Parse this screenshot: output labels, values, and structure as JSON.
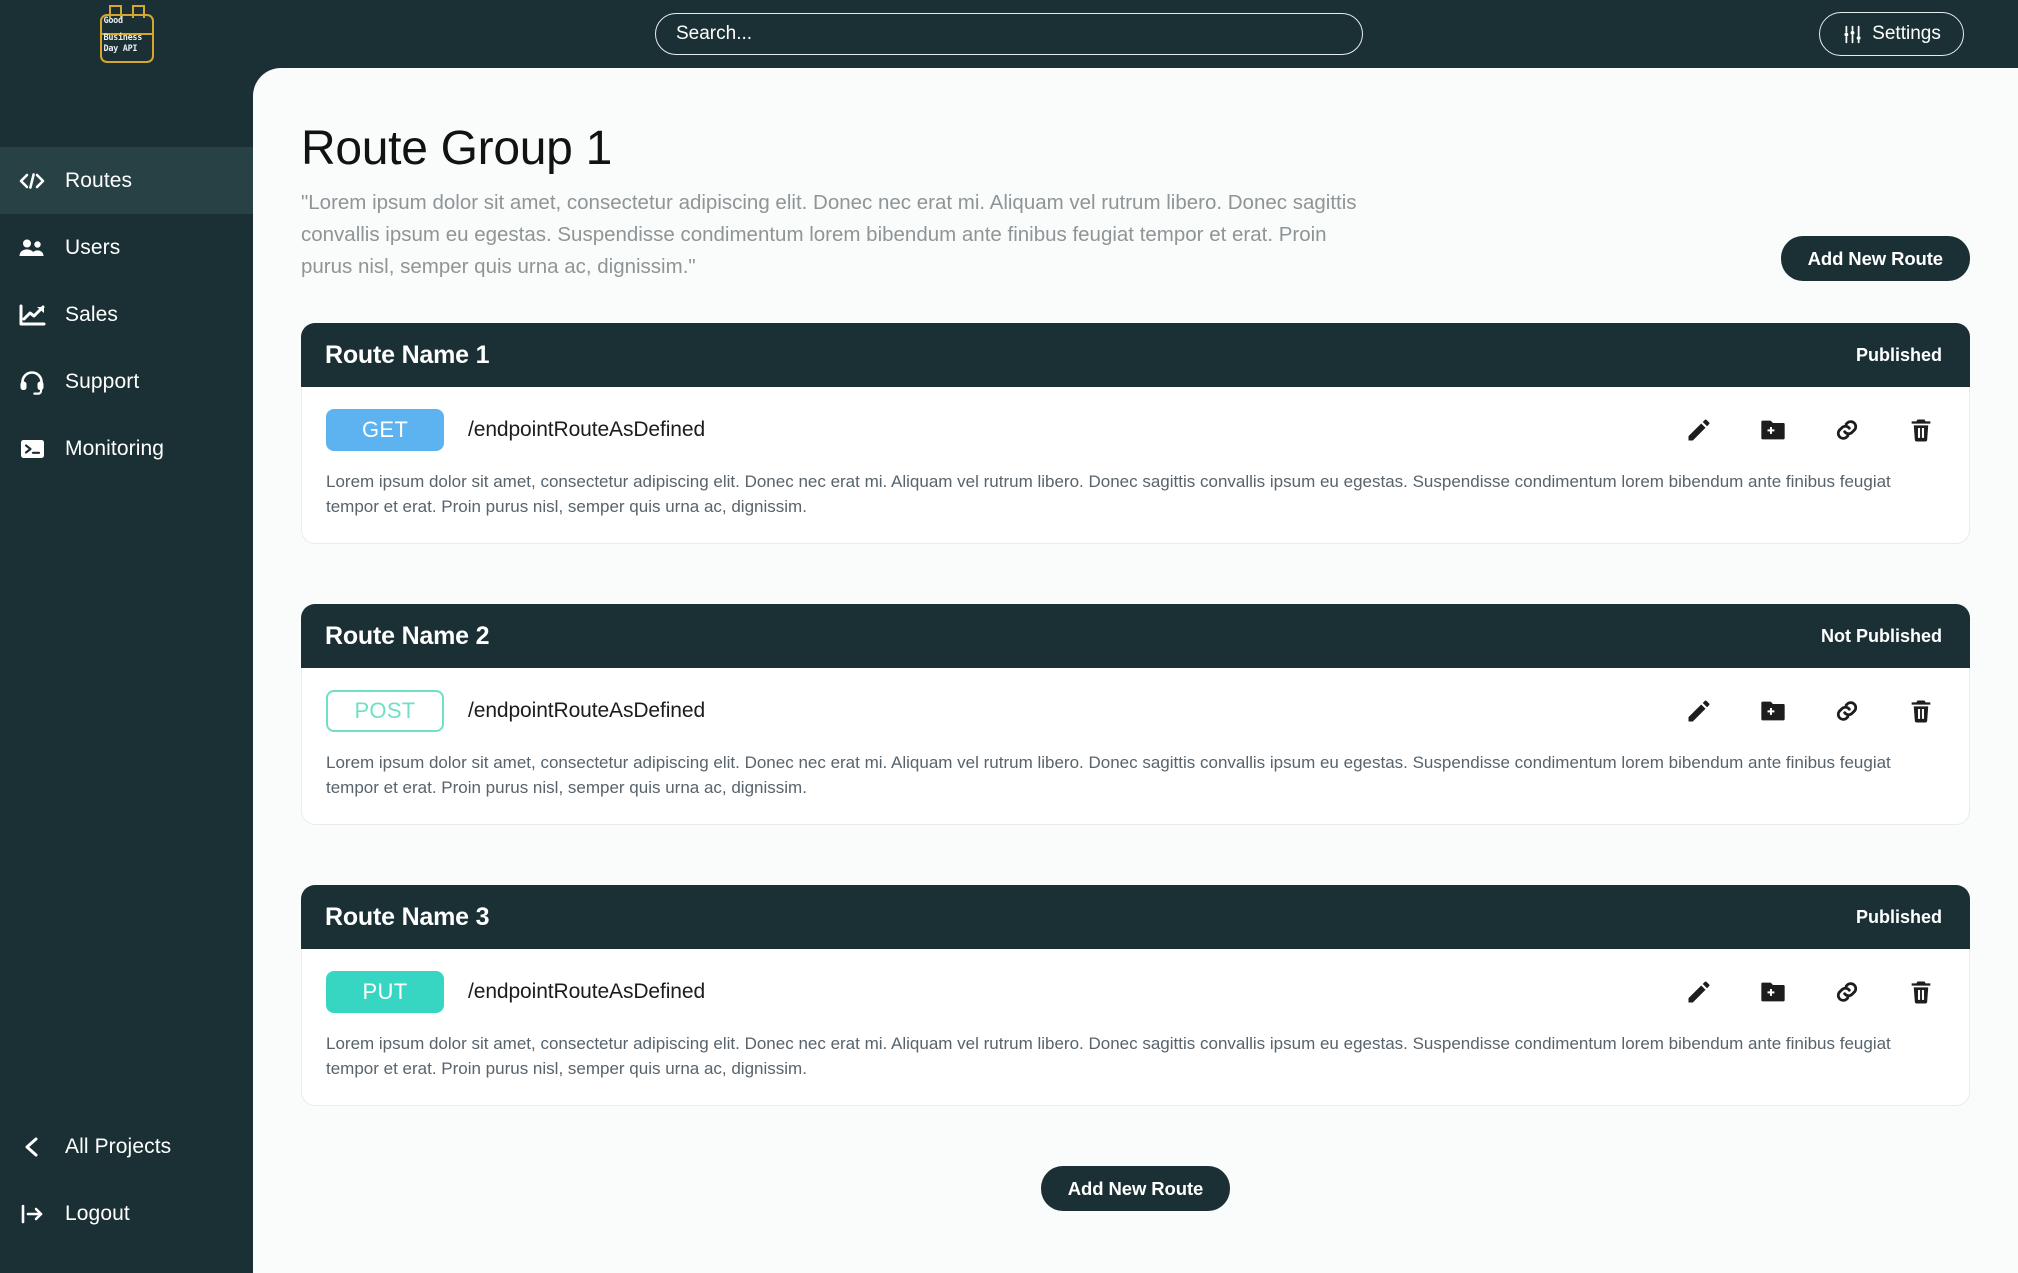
{
  "brand": {
    "logo_line1": "Good",
    "logo_line2": "Business",
    "logo_line3": "Day API",
    "logo_icon": "calendar-icon",
    "accent_gold": "#d6a72e",
    "dark": "#1a3034"
  },
  "topbar": {
    "search": {
      "placeholder": "Search...",
      "value": "",
      "icon": "search-input"
    },
    "settings_label": "Settings",
    "settings_icon": "sliders-icon"
  },
  "sidebar": {
    "items": [
      {
        "label": "Routes",
        "icon": "code-brackets-icon",
        "active": true
      },
      {
        "label": "Users",
        "icon": "users-group-icon",
        "active": false
      },
      {
        "label": "Sales",
        "icon": "chart-line-icon",
        "active": false
      },
      {
        "label": "Support",
        "icon": "headset-icon",
        "active": false
      },
      {
        "label": "Monitoring",
        "icon": "terminal-icon",
        "active": false
      }
    ],
    "bottom_items": [
      {
        "label": "All Projects",
        "icon": "chevron-left-icon"
      },
      {
        "label": "Logout",
        "icon": "logout-arrow-icon"
      }
    ]
  },
  "main": {
    "title": "Route Group 1",
    "description": "\"Lorem ipsum dolor sit amet, consectetur adipiscing elit. Donec nec erat mi. Aliquam vel rutrum libero. Donec sagittis convallis ipsum eu egestas. Suspendisse condimentum lorem bibendum ante finibus feugiat tempor et erat. Proin purus nisl, semper quis urna ac, dignissim.\"",
    "add_route_top_label": "Add New Route",
    "add_route_bottom_label": "Add New Route",
    "route_action_icons": [
      "pencil-icon",
      "folder-plus-icon",
      "link-icon",
      "trash-icon"
    ],
    "method_colors": {
      "GET": "#5cb3f0",
      "POST": "#6fe0c6",
      "PUT": "#36d6c3"
    },
    "routes": [
      {
        "name": "Route Name 1",
        "status": "Published",
        "method": "GET",
        "method_style": "get",
        "endpoint": "/endpointRouteAsDefined",
        "description": "Lorem ipsum dolor sit amet, consectetur adipiscing elit. Donec nec erat mi. Aliquam vel rutrum libero. Donec sagittis convallis ipsum eu egestas. Suspendisse condimentum lorem bibendum ante finibus feugiat tempor et erat. Proin purus nisl, semper quis urna ac, dignissim."
      },
      {
        "name": "Route Name 2",
        "status": "Not Published",
        "method": "POST",
        "method_style": "post",
        "endpoint": "/endpointRouteAsDefined",
        "description": "Lorem ipsum dolor sit amet, consectetur adipiscing elit. Donec nec erat mi. Aliquam vel rutrum libero. Donec sagittis convallis ipsum eu egestas. Suspendisse condimentum lorem bibendum ante finibus feugiat tempor et erat. Proin purus nisl, semper quis urna ac, dignissim."
      },
      {
        "name": "Route Name 3",
        "status": "Published",
        "method": "PUT",
        "method_style": "put",
        "endpoint": "/endpointRouteAsDefined",
        "description": "Lorem ipsum dolor sit amet, consectetur adipiscing elit. Donec nec erat mi. Aliquam vel rutrum libero. Donec sagittis convallis ipsum eu egestas. Suspendisse condimentum lorem bibendum ante finibus feugiat tempor et erat. Proin purus nisl, semper quis urna ac, dignissim."
      }
    ]
  }
}
